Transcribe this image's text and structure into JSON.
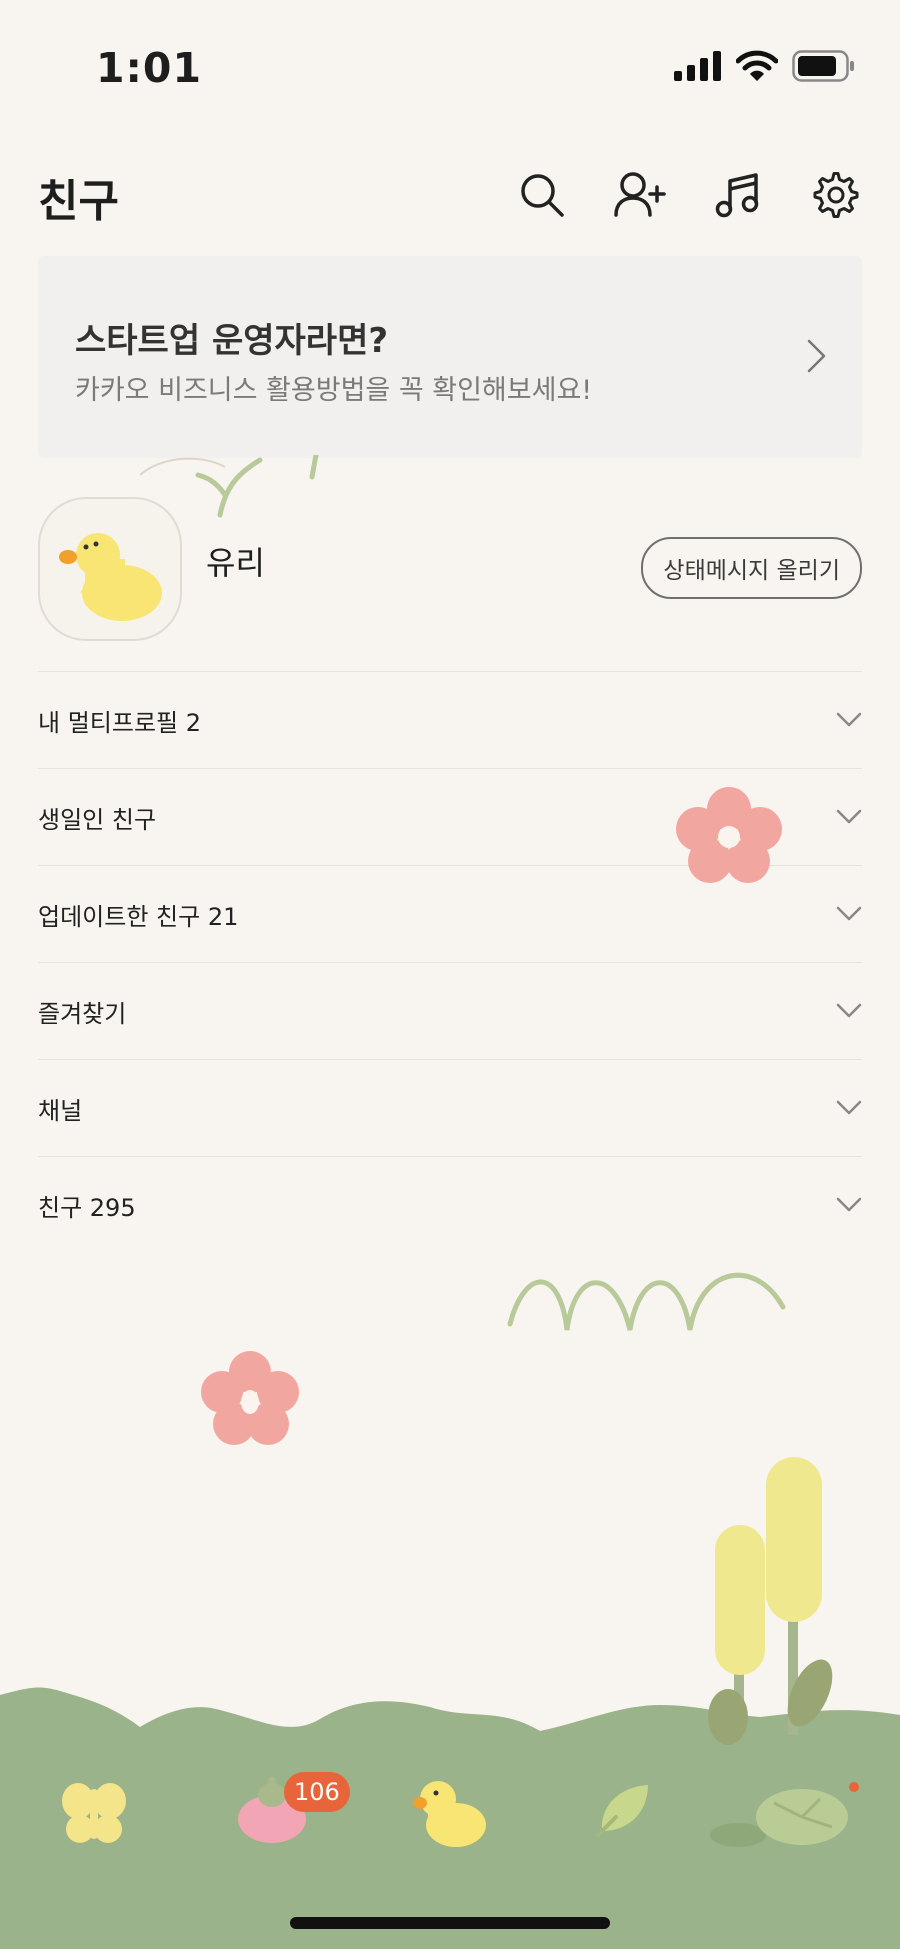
{
  "status_bar": {
    "time": "1:01"
  },
  "header": {
    "title": "친구"
  },
  "banner": {
    "title": "스타트업 운영자라면?",
    "subtitle": "카카오 비즈니스 활용방법을 꼭 확인해보세요!"
  },
  "profile": {
    "name": "유리",
    "status_button": "상태메시지 올리기"
  },
  "sections": [
    {
      "label": "내 멀티프로필 2"
    },
    {
      "label": "생일인 친구"
    },
    {
      "label": "업데이트한 친구 21"
    },
    {
      "label": "즐겨찾기"
    },
    {
      "label": "채널"
    },
    {
      "label": "친구 295"
    }
  ],
  "tabbar": {
    "chats_badge": "106"
  },
  "colors": {
    "background": "#f8f4ef",
    "ground": "#9bb38a",
    "badge": "#e8643a",
    "banner": "#f1f0ef"
  }
}
